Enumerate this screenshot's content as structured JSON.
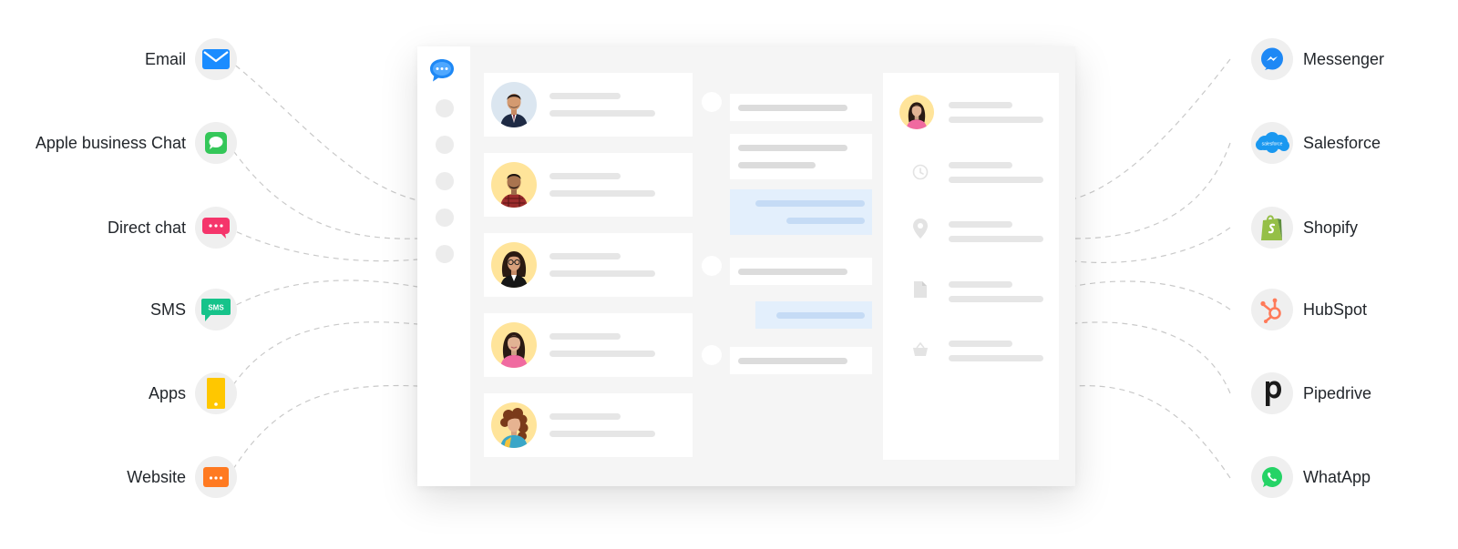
{
  "channels_left": [
    {
      "label": "Email",
      "icon": "envelope-icon",
      "color": "#1a8cff"
    },
    {
      "label": "Apple business Chat",
      "icon": "chat-bubble-icon",
      "color": "#34c759"
    },
    {
      "label": "Direct chat",
      "icon": "direct-chat-icon",
      "color": "#f5356b"
    },
    {
      "label": "SMS",
      "icon": "sms-icon",
      "badge": "SMS",
      "color": "#16c38a"
    },
    {
      "label": "Apps",
      "icon": "mobile-phone-icon",
      "color": "#ffc700"
    },
    {
      "label": "Website",
      "icon": "browser-icon",
      "color": "#ff7a21"
    }
  ],
  "channels_right": [
    {
      "label": "Messenger",
      "icon": "messenger-icon",
      "color": "#1e88f5"
    },
    {
      "label": "Salesforce",
      "icon": "salesforce-icon",
      "badge": "salesforce",
      "color": "#1a98f0"
    },
    {
      "label": "Shopify",
      "icon": "shopify-icon",
      "color": "#95bf47"
    },
    {
      "label": "HubSpot",
      "icon": "hubspot-icon",
      "color": "#ff7a59"
    },
    {
      "label": "Pipedrive",
      "icon": "pipedrive-icon",
      "color": "#1a1a1a"
    },
    {
      "label": "WhatApp",
      "icon": "whatsapp-icon",
      "color": "#25d366"
    }
  ],
  "app_window": {
    "accent_color": "#1e88f5",
    "contacts": [
      {
        "avatar": "avatar-man-suit",
        "bg": "#dbe6f0"
      },
      {
        "avatar": "avatar-man-plaid-shirt",
        "bg": "#ffe49a"
      },
      {
        "avatar": "avatar-woman-glasses",
        "bg": "#ffe49a"
      },
      {
        "avatar": "avatar-woman-pink",
        "bg": "#ffe49a"
      },
      {
        "avatar": "avatar-woman-curly-hair",
        "bg": "#ffe49a"
      }
    ],
    "detail_icons": [
      "clock-icon",
      "location-pin-icon",
      "document-icon",
      "basket-icon"
    ]
  }
}
